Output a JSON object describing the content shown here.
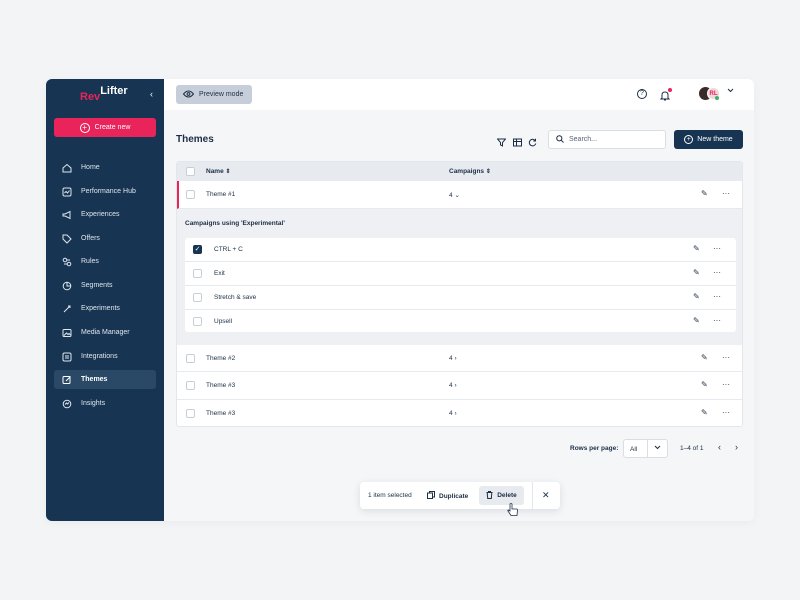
{
  "brand": {
    "logo_part1": "Rev",
    "logo_part2": "Lifter"
  },
  "sidebar": {
    "collapse_glyph": "‹",
    "create_label": "Create new",
    "items": [
      {
        "label": "Home",
        "icon": "home-icon"
      },
      {
        "label": "Performance Hub",
        "icon": "chart-icon"
      },
      {
        "label": "Experiences",
        "icon": "megaphone-icon"
      },
      {
        "label": "Offers",
        "icon": "tag-icon"
      },
      {
        "label": "Rules",
        "icon": "rules-icon"
      },
      {
        "label": "Segments",
        "icon": "segments-icon"
      },
      {
        "label": "Experiments",
        "icon": "flask-icon"
      },
      {
        "label": "Media Manager",
        "icon": "image-icon"
      },
      {
        "label": "Integrations",
        "icon": "integrations-icon"
      },
      {
        "label": "Themes",
        "icon": "edit-icon",
        "active": true
      },
      {
        "label": "Insights",
        "icon": "insights-icon"
      }
    ]
  },
  "topbar": {
    "preview_label": "Preview mode",
    "help_glyph": "?",
    "avatar_initials": "RL"
  },
  "page": {
    "title": "Themes",
    "search_placeholder": "Search...",
    "new_theme_label": "New theme"
  },
  "table": {
    "columns": {
      "name": "Name",
      "campaigns": "Campaigns"
    },
    "rows": [
      {
        "name": "Theme #1",
        "campaigns": "4",
        "expanded": true
      },
      {
        "name": "Theme #2",
        "campaigns": "4"
      },
      {
        "name": "Theme #3",
        "campaigns": "4"
      },
      {
        "name": "Theme #3",
        "campaigns": "4"
      }
    ],
    "expanded_title": "Campaigns using 'Experimental'",
    "sub_rows": [
      {
        "name": "CTRL + C",
        "checked": true
      },
      {
        "name": "Exit",
        "checked": false
      },
      {
        "name": "Stretch & save",
        "checked": false
      },
      {
        "name": "Upsell",
        "checked": false
      }
    ]
  },
  "pagination": {
    "rows_per_page_label": "Rows per page:",
    "rows_per_page_value": "All",
    "range_label": "1–4 of 1"
  },
  "action_bar": {
    "selected_label": "1 item selected",
    "duplicate_label": "Duplicate",
    "delete_label": "Delete",
    "close_glyph": "✕"
  },
  "glyphs": {
    "more": "···",
    "check": "✓"
  },
  "colors": {
    "accent": "#e8245b",
    "navy": "#173552",
    "sidebar_active": "#2a4967"
  }
}
